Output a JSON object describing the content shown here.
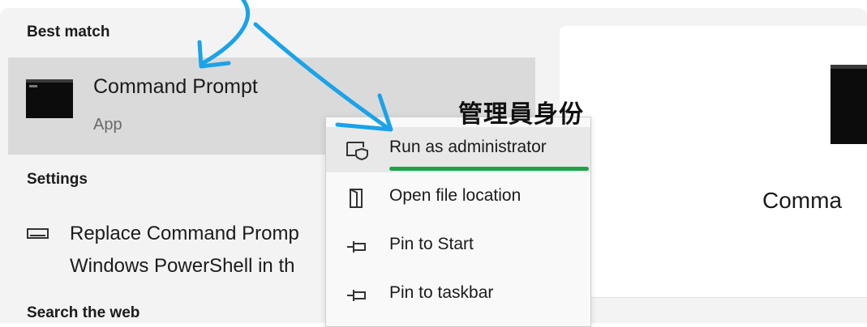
{
  "left": {
    "best_match_heading": "Best match",
    "best_match": {
      "title": "Command Prompt",
      "subtitle": "App",
      "icon": "command-prompt-icon"
    },
    "settings_heading": "Settings",
    "settings_item": {
      "line1": "Replace Command Promp",
      "line2": "Windows PowerShell in th",
      "icon": "display-settings-icon"
    },
    "search_web_heading": "Search the web"
  },
  "context_menu": {
    "items": [
      {
        "label": "Run as administrator",
        "icon": "run-as-admin-shield-icon",
        "highlighted": true
      },
      {
        "label": "Open file location",
        "icon": "open-folder-icon"
      },
      {
        "label": "Pin to Start",
        "icon": "pin-icon"
      },
      {
        "label": "Pin to taskbar",
        "icon": "pin-icon"
      }
    ]
  },
  "annotations": {
    "label": "管理員身份",
    "underline_color": "#1fa34a",
    "arrow_color": "#1aa3e8"
  },
  "preview": {
    "title": "Comma",
    "icon": "command-prompt-icon"
  }
}
